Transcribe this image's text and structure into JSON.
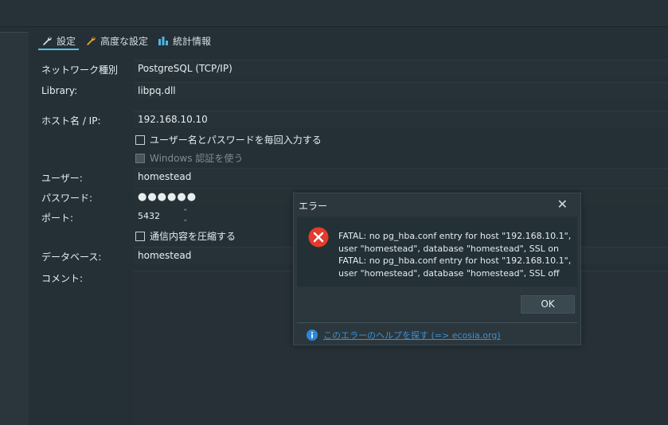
{
  "tabs": [
    {
      "label": "設定",
      "icon": "wrench-icon"
    },
    {
      "label": "高度な設定",
      "icon": "wrench-orange-icon"
    },
    {
      "label": "統計情報",
      "icon": "bar-chart-icon"
    }
  ],
  "form": {
    "network_label": "ネットワーク種別",
    "network_value": "PostgreSQL (TCP/IP)",
    "library_label": "Library:",
    "library_value": "libpq.dll",
    "host_label": "ホスト名 / IP:",
    "host_value": "192.168.10.10",
    "prompt_cb_label": "ユーザー名とパスワードを毎回入力する",
    "windows_auth_label": "Windows 認証を使う",
    "user_label": "ユーザー:",
    "user_value": "homestead",
    "password_label": "パスワード:",
    "password_value": "●●●●●●",
    "port_label": "ポート:",
    "port_value": "5432",
    "compress_label": "通信内容を圧縮する",
    "database_label": "データベース:",
    "database_value": "homestead",
    "comment_label": "コメント:"
  },
  "dialog": {
    "title": "エラー",
    "close": "✕",
    "message": "FATAL:  no pg_hba.conf entry for host \"192.168.10.1\",\nuser \"homestead\", database \"homestead\", SSL on\nFATAL:  no pg_hba.conf entry for host \"192.168.10.1\",\nuser \"homestead\", database \"homestead\", SSL off",
    "ok_label": "OK",
    "help_text": "このエラーのヘルプを探す (=> ecosia.org)"
  },
  "colors": {
    "accent": "#5bc0de",
    "error_red": "#e53b2c",
    "link_blue": "#3f8fd0"
  }
}
